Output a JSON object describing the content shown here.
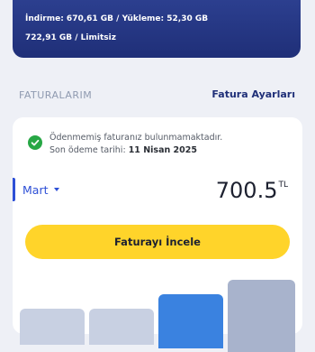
{
  "usage": {
    "line1": "İndirme: 670,61 GB / Yükleme: 52,30 GB",
    "line2": "722,91 GB / Limitsiz"
  },
  "header": {
    "title": "FATURALARIM",
    "settings_link": "Fatura Ayarları"
  },
  "bill": {
    "status_message": "Ödenmemiş faturanız bulunmamaktadır.",
    "due_label": "Son ödeme tarihi:",
    "due_date": "11 Nisan 2025",
    "month": "Mart",
    "amount": "700.5",
    "currency": "TL",
    "review_button": "Faturayı İncele"
  },
  "history_bars": {
    "values": [
      2,
      2,
      3,
      4
    ],
    "highlighted_index": 2
  },
  "colors": {
    "brand_navy": "#1f2f78",
    "accent_blue": "#2d4fd6",
    "button_yellow": "#ffd42a",
    "success_green": "#27a745"
  },
  "icons": {
    "status": "check-circle-icon",
    "month_dropdown": "chevron-down-icon"
  }
}
